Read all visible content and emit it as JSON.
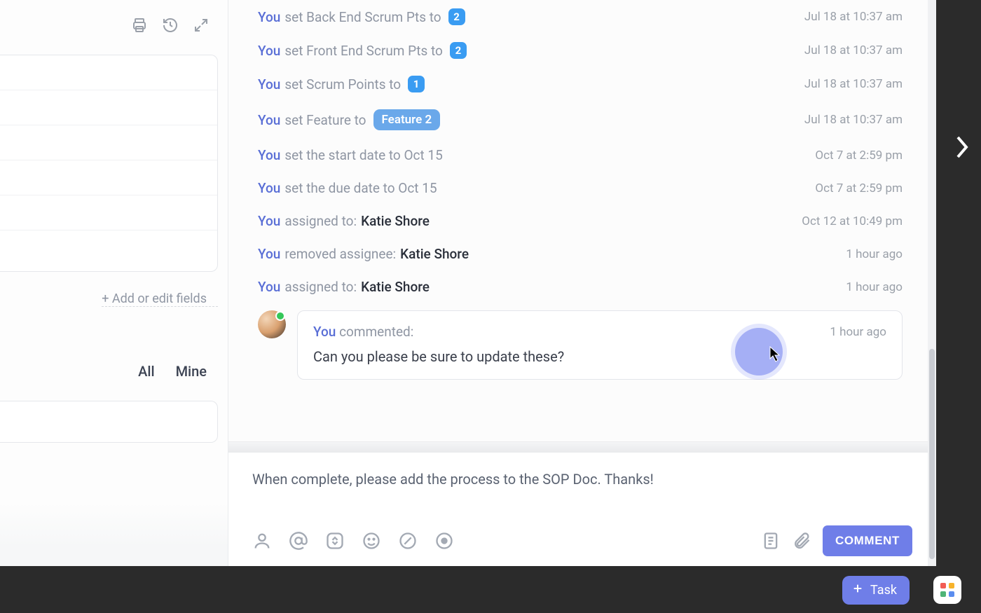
{
  "left": {
    "add_fields_label": "+ Add or edit fields",
    "tabs": {
      "all": "All",
      "mine": "Mine"
    }
  },
  "activity": [
    {
      "actor": "You",
      "verb": "set Back End Scrum Pts to",
      "badge": "2",
      "badge_type": "num",
      "time": "Jul 18 at 10:37 am"
    },
    {
      "actor": "You",
      "verb": "set Front End Scrum Pts to",
      "badge": "2",
      "badge_type": "num",
      "time": "Jul 18 at 10:37 am"
    },
    {
      "actor": "You",
      "verb": "set Scrum Points to",
      "badge": "1",
      "badge_type": "num",
      "time": "Jul 18 at 10:37 am"
    },
    {
      "actor": "You",
      "verb": "set Feature to",
      "badge": "Feature 2",
      "badge_type": "feature",
      "time": "Jul 18 at 10:37 am"
    },
    {
      "actor": "You",
      "verb": "set the start date to Oct 15",
      "time": "Oct 7 at 2:59 pm"
    },
    {
      "actor": "You",
      "verb": "set the due date to Oct 15",
      "time": "Oct 7 at 2:59 pm"
    },
    {
      "actor": "You",
      "verb": "assigned to:",
      "target": "Katie Shore",
      "time": "Oct 12 at 10:49 pm"
    },
    {
      "actor": "You",
      "verb": "removed assignee:",
      "target": "Katie Shore",
      "time": "1 hour ago"
    },
    {
      "actor": "You",
      "verb": "assigned to:",
      "target": "Katie Shore",
      "time": "1 hour ago"
    }
  ],
  "comment": {
    "actor": "You",
    "head_suffix": "commented:",
    "body": "Can you please be sure to update these?",
    "time": "1 hour ago"
  },
  "composer": {
    "text": "When complete, please add the process to the SOP Doc. Thanks!",
    "button_label": "COMMENT"
  },
  "fab": {
    "task_label": "Task"
  }
}
